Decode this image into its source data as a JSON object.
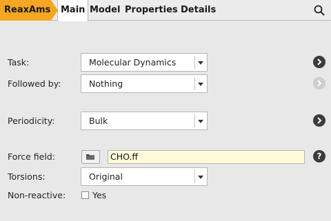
{
  "header": {
    "breadcrumb": "ReaxAms",
    "tabs": [
      {
        "label": "Main",
        "active": true
      },
      {
        "label": "Model",
        "active": false
      },
      {
        "label": "Properties",
        "active": false
      },
      {
        "label": "Details",
        "active": false
      }
    ],
    "search_icon": "search-icon"
  },
  "form": {
    "task": {
      "label": "Task:",
      "value": "Molecular Dynamics"
    },
    "followed_by": {
      "label": "Followed by:",
      "value": "Nothing"
    },
    "periodicity": {
      "label": "Periodicity:",
      "value": "Bulk"
    },
    "force_field": {
      "label": "Force field:",
      "value": "CHO.ff"
    },
    "torsions": {
      "label": "Torsions:",
      "value": "Original"
    },
    "non_reactive": {
      "label": "Non-reactive:",
      "checkbox_label": "Yes",
      "checked": false
    }
  },
  "help_glyph": "?",
  "colors": {
    "breadcrumb": "#f5a623",
    "background": "#e8e8e8",
    "input_highlight": "#fdfbd9",
    "round_button": "#3c3c3c",
    "round_button_disabled": "#cdcdcd"
  }
}
